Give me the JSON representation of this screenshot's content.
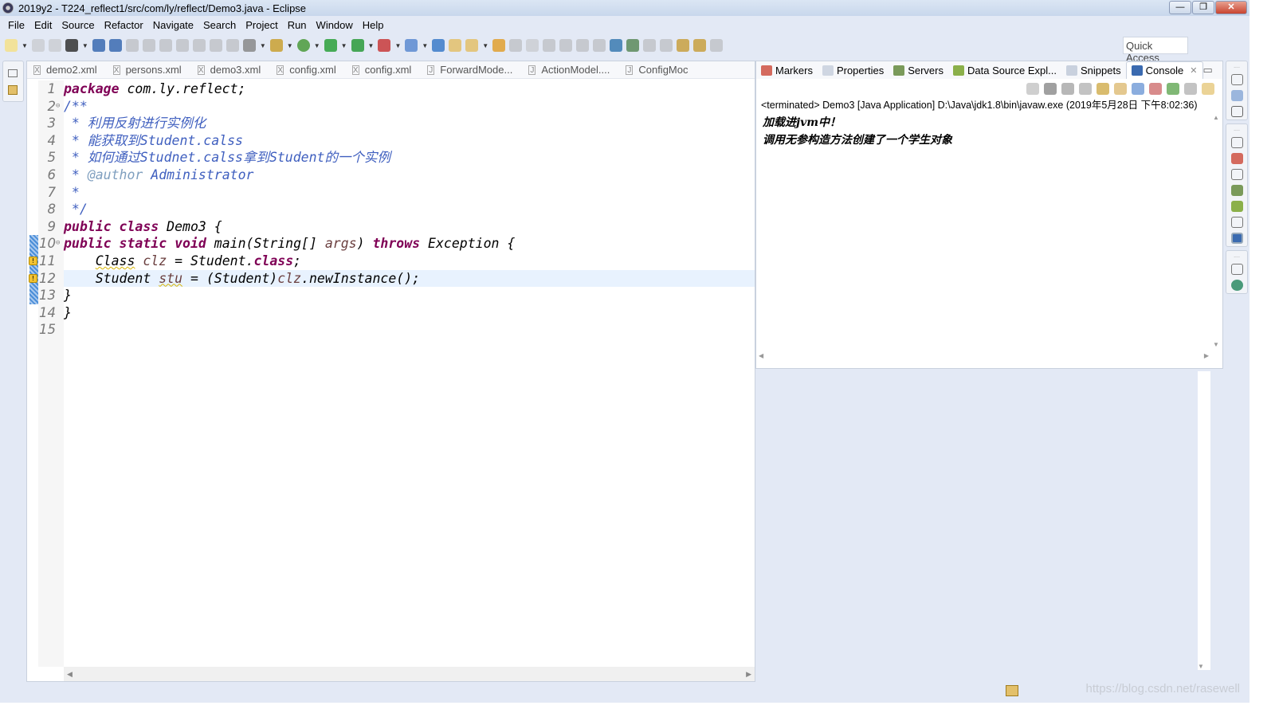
{
  "window": {
    "title": "2019y2 - T224_reflect1/src/com/ly/reflect/Demo3.java - Eclipse",
    "buttons": [
      "minimize",
      "restore",
      "close"
    ]
  },
  "menu": [
    "File",
    "Edit",
    "Source",
    "Refactor",
    "Navigate",
    "Search",
    "Project",
    "Run",
    "Window",
    "Help"
  ],
  "toolbar": {
    "quick_access_placeholder": "Quick Access"
  },
  "editor": {
    "tabs": [
      {
        "label": "demo2.xml",
        "icon": "xml-file-icon"
      },
      {
        "label": "persons.xml",
        "icon": "xml-file-icon"
      },
      {
        "label": "demo3.xml",
        "icon": "xml-file-icon"
      },
      {
        "label": "config.xml",
        "icon": "xml-file-icon"
      },
      {
        "label": "config.xml",
        "icon": "xml-file-icon"
      },
      {
        "label": "ForwardMode...",
        "icon": "java-file-icon"
      },
      {
        "label": "ActionModel....",
        "icon": "java-file-icon"
      },
      {
        "label": "ConfigMoc",
        "icon": "java-file-icon"
      }
    ],
    "current_line": 12,
    "lines": [
      [
        [
          "package",
          "k"
        ],
        [
          " com.ly.reflect;",
          "p"
        ]
      ],
      [
        [
          "/**",
          "c"
        ]
      ],
      [
        [
          " * 利用反射进行实例化",
          "c"
        ]
      ],
      [
        [
          " * 能获取到Student.calss",
          "c"
        ]
      ],
      [
        [
          " * 如何通过Studnet.calss拿到Student的一个实例",
          "c"
        ]
      ],
      [
        [
          " * ",
          "c"
        ],
        [
          "@author",
          "ca"
        ],
        [
          " Administrator",
          "c"
        ]
      ],
      [
        [
          " *",
          "c"
        ]
      ],
      [
        [
          " */",
          "c"
        ]
      ],
      [
        [
          "public",
          "k"
        ],
        [
          " ",
          "p"
        ],
        [
          "class",
          "k"
        ],
        [
          " Demo3 {",
          "p"
        ]
      ],
      [
        [
          "public",
          "k"
        ],
        [
          " ",
          "p"
        ],
        [
          "static",
          "k"
        ],
        [
          " ",
          "p"
        ],
        [
          "void",
          "k"
        ],
        [
          " main(String[] ",
          "p"
        ],
        [
          "args",
          "v"
        ],
        [
          ") ",
          "p"
        ],
        [
          "throws",
          "k"
        ],
        [
          " Exception {",
          "p"
        ]
      ],
      [
        [
          "    ",
          "p"
        ],
        [
          "Class",
          "pw"
        ],
        [
          " ",
          "p"
        ],
        [
          "clz",
          "v"
        ],
        [
          " = Student.",
          "p"
        ],
        [
          "class",
          "k"
        ],
        [
          ";",
          "p"
        ]
      ],
      [
        [
          "    Student ",
          "p"
        ],
        [
          "stu",
          "vw"
        ],
        [
          " = (Student)",
          "p"
        ],
        [
          "clz",
          "v"
        ],
        [
          ".newInstance();",
          "p"
        ]
      ],
      [
        [
          "}",
          "p"
        ]
      ],
      [
        [
          "}",
          "p"
        ]
      ],
      []
    ]
  },
  "console": {
    "tabs": [
      {
        "label": "Markers",
        "icon": "markers-icon"
      },
      {
        "label": "Properties",
        "icon": "properties-icon"
      },
      {
        "label": "Servers",
        "icon": "servers-icon"
      },
      {
        "label": "Data Source Expl...",
        "icon": "data-source-icon"
      },
      {
        "label": "Snippets",
        "icon": "snippets-icon"
      },
      {
        "label": "Console",
        "icon": "console-icon",
        "active": true
      }
    ],
    "status": "<terminated> Demo3 [Java Application] D:\\Java\\jdk1.8\\bin\\javaw.exe (2019年5月28日 下午8:02:36)",
    "output": [
      "加载进jvm中！",
      "调用无参构造方法创建了一个学生对象"
    ]
  },
  "statusbar": {
    "watermark": "https://blog.csdn.net/rasewell"
  }
}
